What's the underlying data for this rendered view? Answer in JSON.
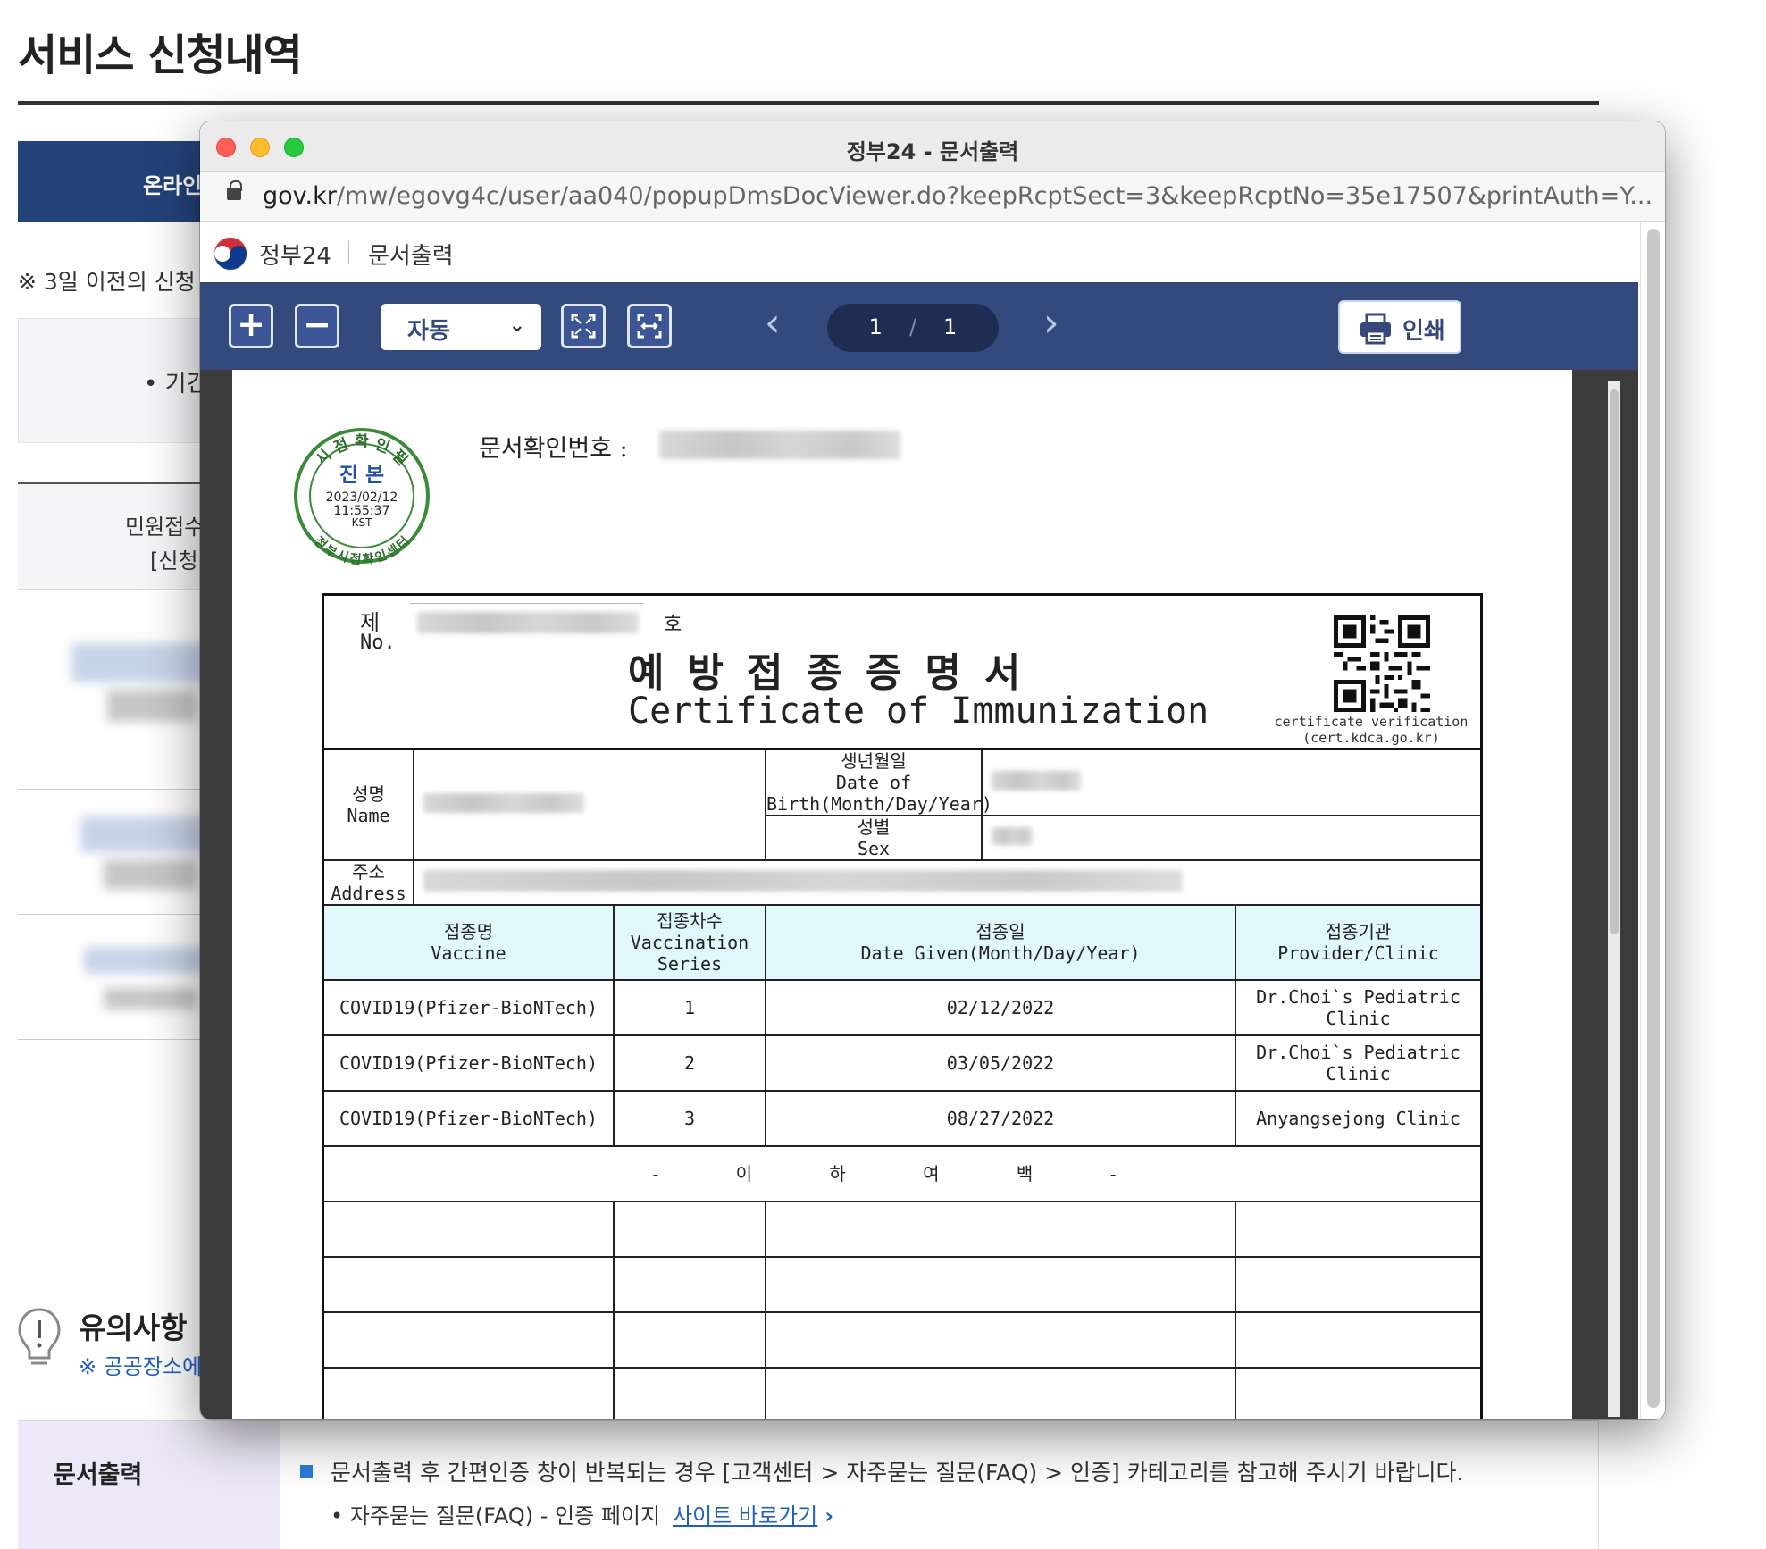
{
  "background": {
    "page_title": "서비스 신청내역",
    "tab_label": "온라인",
    "notice_line": "※ 3일 이전의 신청",
    "filter_label": "• 기긴",
    "table_header_1": "민원접수",
    "table_header_2": "[신청",
    "caution_title": "유의사항",
    "caution_sub": "※ 공공장소에",
    "footer": {
      "label": "문서출력",
      "line1": "문서출력 후 간편인증 창이 반복되는 경우 [고객센터 > 자주묻는 질문(FAQ) > 인증] 카테고리를 참고해 주시기 바랍니다.",
      "line2": "• 자주묻는 질문(FAQ) - 인증 페이지",
      "link": "사이트 바로가기"
    }
  },
  "popup": {
    "window_title": "정부24 - 문서출력",
    "url_host": "gov.kr",
    "url_path": "/mw/egovg4c/user/aa040/popupDmsDocViewer.do?keepRcptSect=3&keepRcptNo=35e17507&printAuth=Y...",
    "site_name": "정부24",
    "site_page": "문서출력",
    "toolbar": {
      "zoom_mode": "자동",
      "page_current": "1",
      "page_separator": "/",
      "page_total": "1",
      "print_label": "인쇄"
    }
  },
  "document": {
    "seal": {
      "top_text": "시 점 확 인 필",
      "center_text": "진 본",
      "date": "2023/02/12",
      "time": "11:55:37",
      "tz": "KST",
      "bottom_text": "정부시점확인센터"
    },
    "doc_id_label": "문서확인번호 :",
    "no_label_kor": "제",
    "no_label_eng": "No.",
    "no_suffix": "호",
    "title_kor": "예방접종증명서",
    "title_eng": "Certificate of Immunization",
    "qr_caption_1": "certificate verification",
    "qr_caption_2": "(cert.kdca.go.kr)",
    "name_kor": "성명",
    "name_eng": "Name",
    "dob_kor": "생년월일",
    "dob_eng": "Date of Birth(Month/Day/Year)",
    "sex_kor": "성별",
    "sex_eng": "Sex",
    "address_kor": "주소",
    "address_eng": "Address",
    "columns": [
      {
        "kor": "접종명",
        "eng": "Vaccine"
      },
      {
        "kor": "접종차수",
        "eng": "Vaccination Series"
      },
      {
        "kor": "접종일",
        "eng": "Date Given(Month/Day/Year)"
      },
      {
        "kor": "접종기관",
        "eng": "Provider/Clinic"
      }
    ],
    "rows": [
      {
        "vaccine": "COVID19(Pfizer-BioNTech)",
        "series": "1",
        "date": "02/12/2022",
        "provider": "Dr.Choi`s Pediatric Clinic"
      },
      {
        "vaccine": "COVID19(Pfizer-BioNTech)",
        "series": "2",
        "date": "03/05/2022",
        "provider": "Dr.Choi`s Pediatric Clinic"
      },
      {
        "vaccine": "COVID19(Pfizer-BioNTech)",
        "series": "3",
        "date": "08/27/2022",
        "provider": "Anyangsejong Clinic"
      }
    ],
    "end_marker": "- 이 하 여 백 -"
  },
  "colors": {
    "toolbar_bg": "#344a7d",
    "tab_bg": "#24427a",
    "table_header_bg": "#e0f8fb",
    "footer_label_bg": "#ece8f7",
    "link": "#1f5fbf"
  },
  "icons": [
    "zoom-in-icon",
    "zoom-out-icon",
    "fit-page-icon",
    "fit-width-icon",
    "prev-page-icon",
    "next-page-icon",
    "print-icon",
    "lock-icon",
    "gov-logo-icon",
    "lightbulb-icon",
    "chevron-right-icon"
  ]
}
